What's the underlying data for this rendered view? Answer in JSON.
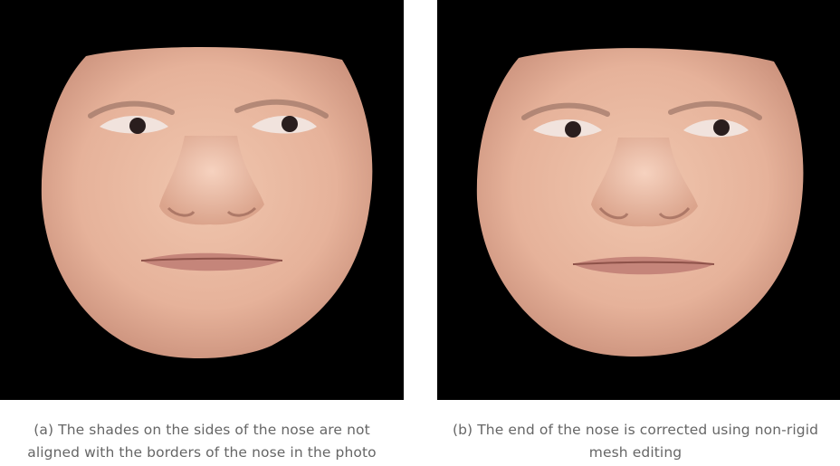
{
  "figure": {
    "panels": [
      {
        "caption_lines": [
          "(a) The shades on the sides of the nose are not",
          "aligned with the borders of the nose in the photo"
        ]
      },
      {
        "caption_lines": [
          "(b) The end of the nose is corrected using non-rigid",
          "mesh editing"
        ]
      }
    ],
    "colors": {
      "background": "#000000",
      "skin": "#e9b9a2",
      "caption_text": "#666666"
    }
  }
}
